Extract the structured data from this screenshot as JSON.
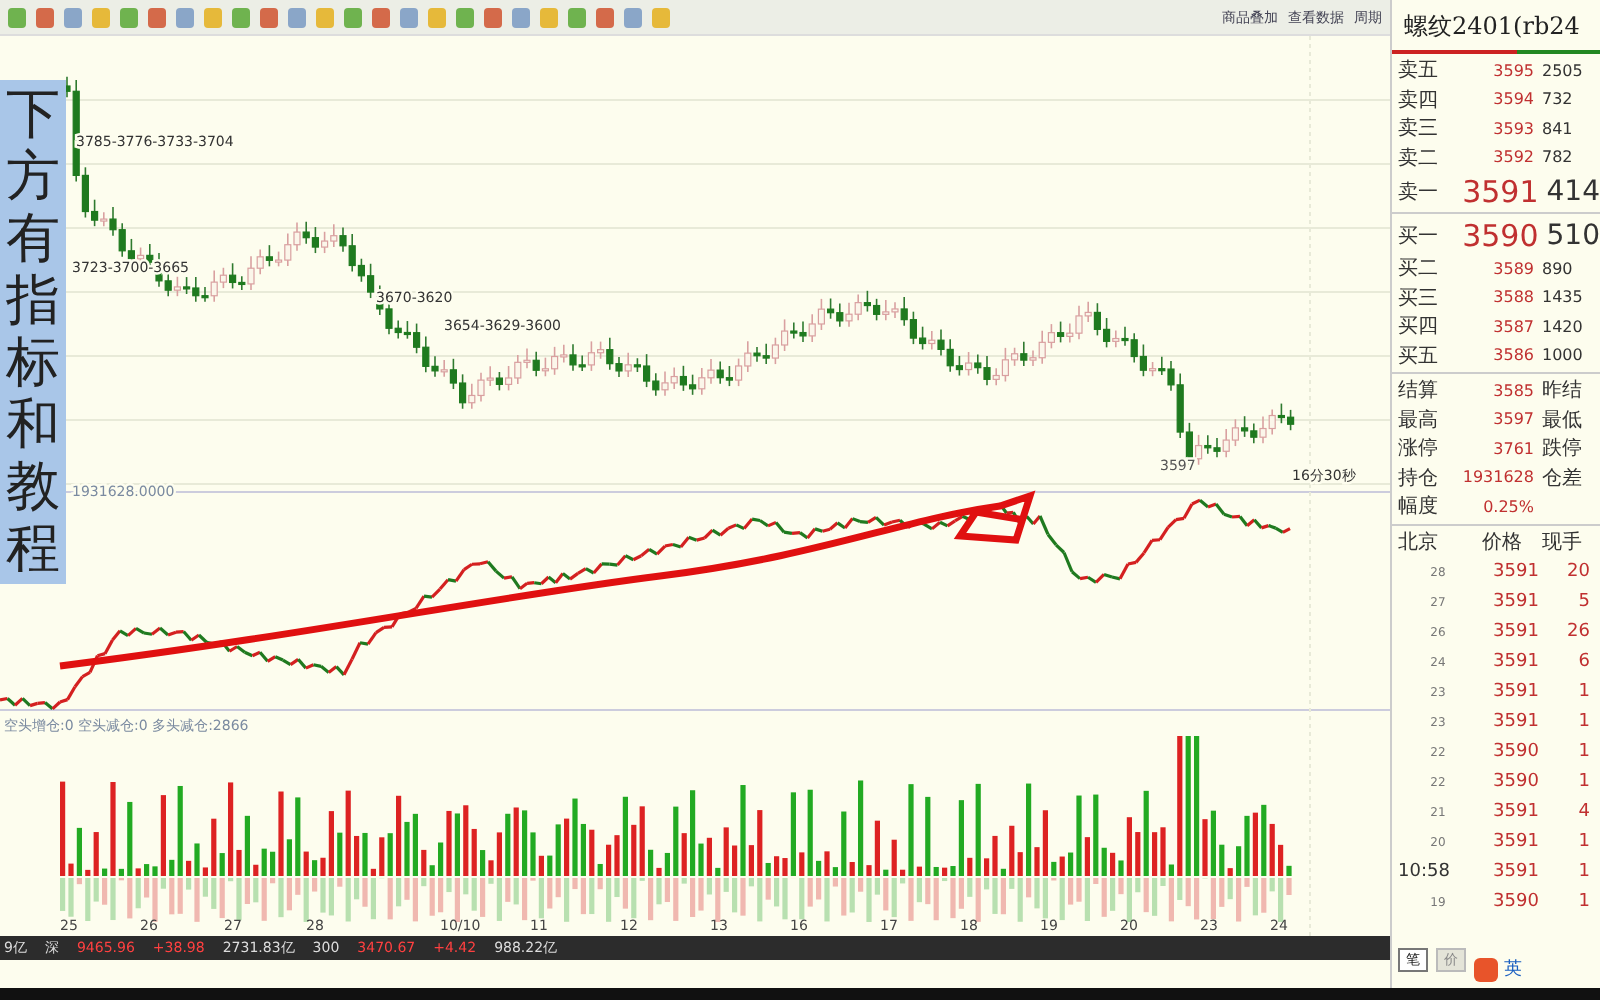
{
  "toolbar": {
    "right_links": [
      "商品叠加",
      "查看数据",
      "周期"
    ]
  },
  "overlay_caption": "下方有指标和教程",
  "price_chart": {
    "annotations": [
      {
        "text": "3785-3776-3733-3704",
        "kind": "above"
      },
      {
        "text": "3723-3700-3665",
        "kind": "above"
      },
      {
        "text": "3670-3620",
        "kind": "above"
      },
      {
        "text": "3654-3629-3600",
        "kind": "above"
      },
      {
        "text": "3597",
        "kind": "low"
      }
    ],
    "countdown": "16分30秒"
  },
  "indicator": {
    "label": "1931628.0000"
  },
  "volume": {
    "label": "空头增仓:0 空头减仓:0 多头减仓:2866"
  },
  "dates": [
    "25",
    "26",
    "27",
    "28",
    "10/10",
    "11",
    "12",
    "13",
    "16",
    "17",
    "18",
    "19",
    "20",
    "23",
    "24"
  ],
  "status_bar": [
    "9亿",
    "深",
    "9465.96",
    "+38.98",
    "2731.83亿",
    "300",
    "3470.67",
    "+4.42",
    "988.22亿"
  ],
  "quote": {
    "title": "螺纹2401(rb24",
    "asks": [
      {
        "label": "卖五",
        "price": "3595",
        "volume": "2505",
        "best": false
      },
      {
        "label": "卖四",
        "price": "3594",
        "volume": "732",
        "best": false
      },
      {
        "label": "卖三",
        "price": "3593",
        "volume": "841",
        "best": false
      },
      {
        "label": "卖二",
        "price": "3592",
        "volume": "782",
        "best": false
      },
      {
        "label": "卖一",
        "price": "3591",
        "volume": "414",
        "best": true
      }
    ],
    "bids": [
      {
        "label": "买一",
        "price": "3590",
        "volume": "510",
        "best": true
      },
      {
        "label": "买二",
        "price": "3589",
        "volume": "890",
        "best": false
      },
      {
        "label": "买三",
        "price": "3588",
        "volume": "1435",
        "best": false
      },
      {
        "label": "买四",
        "price": "3587",
        "volume": "1420",
        "best": false
      },
      {
        "label": "买五",
        "price": "3586",
        "volume": "1000",
        "best": false
      }
    ],
    "stats": [
      {
        "label": "结算",
        "value": "3585",
        "label2": "昨结"
      },
      {
        "label": "最高",
        "value": "3597",
        "label2": "最低"
      },
      {
        "label": "涨停",
        "value": "3761",
        "label2": "跌停"
      },
      {
        "label": "持仓",
        "value": "1931628",
        "label2": "仓差"
      },
      {
        "label": "幅度",
        "value": "0.25%"
      }
    ],
    "trade_headers": [
      "北京",
      "价格",
      "现手"
    ],
    "trades": [
      {
        "time": "28",
        "price": "3591",
        "volume": "20"
      },
      {
        "time": "27",
        "price": "3591",
        "volume": "5"
      },
      {
        "time": "26",
        "price": "3591",
        "volume": "26"
      },
      {
        "time": "24",
        "price": "3591",
        "volume": "6"
      },
      {
        "time": "23",
        "price": "3591",
        "volume": "1"
      },
      {
        "time": "23",
        "price": "3591",
        "volume": "1"
      },
      {
        "time": "22",
        "price": "3590",
        "volume": "1"
      },
      {
        "time": "22",
        "price": "3590",
        "volume": "1"
      },
      {
        "time": "21",
        "price": "3591",
        "volume": "4"
      },
      {
        "time": "20",
        "price": "3591",
        "volume": "1"
      },
      {
        "time": "10:58",
        "price": "3591",
        "volume": "1"
      },
      {
        "time": "19",
        "price": "3590",
        "volume": "1"
      }
    ],
    "tabs": [
      {
        "label": "笔",
        "selected": true
      },
      {
        "label": "价",
        "selected": false
      }
    ]
  },
  "ime_bar": {
    "mode": "英"
  }
}
